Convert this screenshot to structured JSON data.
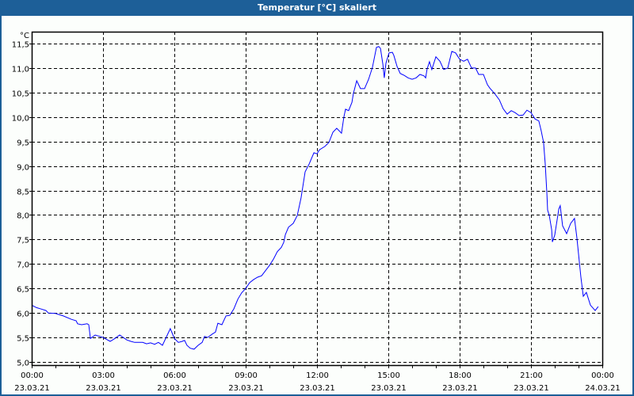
{
  "window": {
    "title": "Temperatur [°C] skaliert"
  },
  "colors": {
    "titlebar": "#1d5f98",
    "line": "#0000ff",
    "grid": "#000000"
  },
  "chart_data": {
    "type": "line",
    "title": "Temperatur [°C] skaliert",
    "ylabel": "°C",
    "xlabel": "",
    "xlim_hours": [
      0,
      24
    ],
    "ylim": [
      5.0,
      11.5
    ],
    "grid": true,
    "y_ticks": [
      {
        "value": 5.0,
        "label": "5,0"
      },
      {
        "value": 5.5,
        "label": "5,5"
      },
      {
        "value": 6.0,
        "label": "6,0"
      },
      {
        "value": 6.5,
        "label": "6,5"
      },
      {
        "value": 7.0,
        "label": "7,0"
      },
      {
        "value": 7.5,
        "label": "7,5"
      },
      {
        "value": 8.0,
        "label": "8,0"
      },
      {
        "value": 8.5,
        "label": "8,5"
      },
      {
        "value": 9.0,
        "label": "9,0"
      },
      {
        "value": 9.5,
        "label": "9,5"
      },
      {
        "value": 10.0,
        "label": "10,0"
      },
      {
        "value": 10.5,
        "label": "10,5"
      },
      {
        "value": 11.0,
        "label": "11,0"
      },
      {
        "value": 11.5,
        "label": "11,5"
      }
    ],
    "x_ticks": [
      {
        "hour": 0,
        "time": "00:00",
        "date": "23.03.21"
      },
      {
        "hour": 3,
        "time": "03:00",
        "date": "23.03.21"
      },
      {
        "hour": 6,
        "time": "06:00",
        "date": "23.03.21"
      },
      {
        "hour": 9,
        "time": "09:00",
        "date": "23.03.21"
      },
      {
        "hour": 12,
        "time": "12:00",
        "date": "23.03.21"
      },
      {
        "hour": 15,
        "time": "15:00",
        "date": "23.03.21"
      },
      {
        "hour": 18,
        "time": "18:00",
        "date": "23.03.21"
      },
      {
        "hour": 21,
        "time": "21:00",
        "date": "23.03.21"
      },
      {
        "hour": 24,
        "time": "00:00",
        "date": "24.03.21"
      }
    ],
    "series": [
      {
        "name": "Temperatur",
        "points": [
          [
            0,
            6.16
          ],
          [
            0.2,
            6.11
          ],
          [
            0.4,
            6.08
          ],
          [
            0.6,
            6.05
          ],
          [
            0.7,
            6.0
          ],
          [
            1,
            5.99
          ],
          [
            1.33,
            5.94
          ],
          [
            1.67,
            5.87
          ],
          [
            1.87,
            5.84
          ],
          [
            1.93,
            5.78
          ],
          [
            2.1,
            5.76
          ],
          [
            2.33,
            5.78
          ],
          [
            2.4,
            5.76
          ],
          [
            2.47,
            5.48
          ],
          [
            2.67,
            5.55
          ],
          [
            2.87,
            5.52
          ],
          [
            3,
            5.5
          ],
          [
            3.3,
            5.42
          ],
          [
            3.47,
            5.47
          ],
          [
            3.7,
            5.55
          ],
          [
            4,
            5.45
          ],
          [
            4.17,
            5.42
          ],
          [
            4.33,
            5.4
          ],
          [
            4.67,
            5.4
          ],
          [
            4.83,
            5.37
          ],
          [
            5,
            5.39
          ],
          [
            5.17,
            5.36
          ],
          [
            5.33,
            5.4
          ],
          [
            5.5,
            5.34
          ],
          [
            5.83,
            5.68
          ],
          [
            6,
            5.48
          ],
          [
            6.17,
            5.4
          ],
          [
            6.33,
            5.42
          ],
          [
            6.43,
            5.44
          ],
          [
            6.53,
            5.34
          ],
          [
            6.67,
            5.28
          ],
          [
            6.83,
            5.26
          ],
          [
            7,
            5.34
          ],
          [
            7.17,
            5.4
          ],
          [
            7.27,
            5.52
          ],
          [
            7.4,
            5.5
          ],
          [
            7.6,
            5.57
          ],
          [
            7.73,
            5.61
          ],
          [
            7.83,
            5.79
          ],
          [
            8,
            5.76
          ],
          [
            8.17,
            5.94
          ],
          [
            8.33,
            5.95
          ],
          [
            8.5,
            6.08
          ],
          [
            8.67,
            6.28
          ],
          [
            8.83,
            6.41
          ],
          [
            9,
            6.5
          ],
          [
            9.17,
            6.62
          ],
          [
            9.33,
            6.68
          ],
          [
            9.5,
            6.73
          ],
          [
            9.67,
            6.76
          ],
          [
            10,
            6.97
          ],
          [
            10.17,
            7.1
          ],
          [
            10.33,
            7.25
          ],
          [
            10.5,
            7.34
          ],
          [
            10.6,
            7.44
          ],
          [
            10.67,
            7.6
          ],
          [
            10.8,
            7.75
          ],
          [
            11,
            7.83
          ],
          [
            11.17,
            7.99
          ],
          [
            11.33,
            8.35
          ],
          [
            11.5,
            8.88
          ],
          [
            11.67,
            9.04
          ],
          [
            11.87,
            9.27
          ],
          [
            12,
            9.25
          ],
          [
            12.1,
            9.33
          ],
          [
            12.33,
            9.4
          ],
          [
            12.5,
            9.48
          ],
          [
            12.67,
            9.69
          ],
          [
            12.83,
            9.77
          ],
          [
            13.03,
            9.67
          ],
          [
            13.13,
            10.0
          ],
          [
            13.2,
            10.16
          ],
          [
            13.33,
            10.13
          ],
          [
            13.47,
            10.3
          ],
          [
            13.53,
            10.48
          ],
          [
            13.67,
            10.74
          ],
          [
            13.83,
            10.58
          ],
          [
            14,
            10.58
          ],
          [
            14.17,
            10.77
          ],
          [
            14.33,
            11.01
          ],
          [
            14.5,
            11.42
          ],
          [
            14.6,
            11.44
          ],
          [
            14.67,
            11.4
          ],
          [
            14.77,
            11.08
          ],
          [
            14.83,
            10.8
          ],
          [
            14.9,
            11.1
          ],
          [
            15.03,
            11.31
          ],
          [
            15.17,
            11.32
          ],
          [
            15.23,
            11.26
          ],
          [
            15.37,
            11.03
          ],
          [
            15.5,
            10.89
          ],
          [
            15.67,
            10.85
          ],
          [
            15.83,
            10.8
          ],
          [
            16,
            10.77
          ],
          [
            16.17,
            10.8
          ],
          [
            16.33,
            10.87
          ],
          [
            16.5,
            10.84
          ],
          [
            16.57,
            10.8
          ],
          [
            16.63,
            10.98
          ],
          [
            16.73,
            11.13
          ],
          [
            16.83,
            10.97
          ],
          [
            17,
            11.23
          ],
          [
            17.17,
            11.14
          ],
          [
            17.33,
            10.97
          ],
          [
            17.5,
            11.0
          ],
          [
            17.67,
            11.34
          ],
          [
            17.83,
            11.31
          ],
          [
            18,
            11.18
          ],
          [
            18.17,
            11.14
          ],
          [
            18.33,
            11.18
          ],
          [
            18.5,
            11.0
          ],
          [
            18.67,
            11.0
          ],
          [
            18.8,
            10.87
          ],
          [
            19,
            10.87
          ],
          [
            19.17,
            10.66
          ],
          [
            19.27,
            10.59
          ],
          [
            19.47,
            10.48
          ],
          [
            19.67,
            10.35
          ],
          [
            19.83,
            10.17
          ],
          [
            20,
            10.06
          ],
          [
            20.17,
            10.13
          ],
          [
            20.33,
            10.09
          ],
          [
            20.5,
            10.03
          ],
          [
            20.67,
            10.04
          ],
          [
            20.83,
            10.14
          ],
          [
            21,
            10.09
          ],
          [
            21.17,
            9.96
          ],
          [
            21.33,
            9.92
          ],
          [
            21.43,
            9.72
          ],
          [
            21.53,
            9.48
          ],
          [
            21.6,
            9.04
          ],
          [
            21.67,
            8.43
          ],
          [
            21.7,
            8.1
          ],
          [
            21.77,
            7.99
          ],
          [
            21.87,
            7.7
          ],
          [
            21.9,
            7.45
          ],
          [
            22,
            7.59
          ],
          [
            22.17,
            8.12
          ],
          [
            22.23,
            8.19
          ],
          [
            22.33,
            7.78
          ],
          [
            22.5,
            7.62
          ],
          [
            22.67,
            7.83
          ],
          [
            22.83,
            7.93
          ],
          [
            22.93,
            7.54
          ],
          [
            23.1,
            6.73
          ],
          [
            23.2,
            6.34
          ],
          [
            23.33,
            6.42
          ],
          [
            23.5,
            6.16
          ],
          [
            23.7,
            6.05
          ],
          [
            23.83,
            6.13
          ]
        ]
      }
    ]
  }
}
